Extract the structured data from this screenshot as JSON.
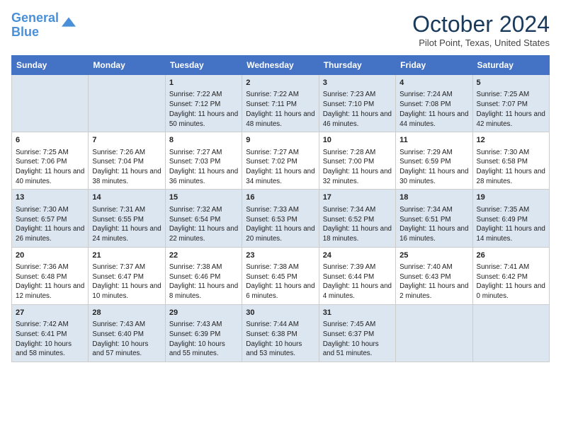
{
  "logo": {
    "line1": "General",
    "line2": "Blue"
  },
  "title": "October 2024",
  "location": "Pilot Point, Texas, United States",
  "days_of_week": [
    "Sunday",
    "Monday",
    "Tuesday",
    "Wednesday",
    "Thursday",
    "Friday",
    "Saturday"
  ],
  "weeks": [
    [
      {
        "day": "",
        "info": ""
      },
      {
        "day": "",
        "info": ""
      },
      {
        "day": "1",
        "info": "Sunrise: 7:22 AM\nSunset: 7:12 PM\nDaylight: 11 hours and 50 minutes."
      },
      {
        "day": "2",
        "info": "Sunrise: 7:22 AM\nSunset: 7:11 PM\nDaylight: 11 hours and 48 minutes."
      },
      {
        "day": "3",
        "info": "Sunrise: 7:23 AM\nSunset: 7:10 PM\nDaylight: 11 hours and 46 minutes."
      },
      {
        "day": "4",
        "info": "Sunrise: 7:24 AM\nSunset: 7:08 PM\nDaylight: 11 hours and 44 minutes."
      },
      {
        "day": "5",
        "info": "Sunrise: 7:25 AM\nSunset: 7:07 PM\nDaylight: 11 hours and 42 minutes."
      }
    ],
    [
      {
        "day": "6",
        "info": "Sunrise: 7:25 AM\nSunset: 7:06 PM\nDaylight: 11 hours and 40 minutes."
      },
      {
        "day": "7",
        "info": "Sunrise: 7:26 AM\nSunset: 7:04 PM\nDaylight: 11 hours and 38 minutes."
      },
      {
        "day": "8",
        "info": "Sunrise: 7:27 AM\nSunset: 7:03 PM\nDaylight: 11 hours and 36 minutes."
      },
      {
        "day": "9",
        "info": "Sunrise: 7:27 AM\nSunset: 7:02 PM\nDaylight: 11 hours and 34 minutes."
      },
      {
        "day": "10",
        "info": "Sunrise: 7:28 AM\nSunset: 7:00 PM\nDaylight: 11 hours and 32 minutes."
      },
      {
        "day": "11",
        "info": "Sunrise: 7:29 AM\nSunset: 6:59 PM\nDaylight: 11 hours and 30 minutes."
      },
      {
        "day": "12",
        "info": "Sunrise: 7:30 AM\nSunset: 6:58 PM\nDaylight: 11 hours and 28 minutes."
      }
    ],
    [
      {
        "day": "13",
        "info": "Sunrise: 7:30 AM\nSunset: 6:57 PM\nDaylight: 11 hours and 26 minutes."
      },
      {
        "day": "14",
        "info": "Sunrise: 7:31 AM\nSunset: 6:55 PM\nDaylight: 11 hours and 24 minutes."
      },
      {
        "day": "15",
        "info": "Sunrise: 7:32 AM\nSunset: 6:54 PM\nDaylight: 11 hours and 22 minutes."
      },
      {
        "day": "16",
        "info": "Sunrise: 7:33 AM\nSunset: 6:53 PM\nDaylight: 11 hours and 20 minutes."
      },
      {
        "day": "17",
        "info": "Sunrise: 7:34 AM\nSunset: 6:52 PM\nDaylight: 11 hours and 18 minutes."
      },
      {
        "day": "18",
        "info": "Sunrise: 7:34 AM\nSunset: 6:51 PM\nDaylight: 11 hours and 16 minutes."
      },
      {
        "day": "19",
        "info": "Sunrise: 7:35 AM\nSunset: 6:49 PM\nDaylight: 11 hours and 14 minutes."
      }
    ],
    [
      {
        "day": "20",
        "info": "Sunrise: 7:36 AM\nSunset: 6:48 PM\nDaylight: 11 hours and 12 minutes."
      },
      {
        "day": "21",
        "info": "Sunrise: 7:37 AM\nSunset: 6:47 PM\nDaylight: 11 hours and 10 minutes."
      },
      {
        "day": "22",
        "info": "Sunrise: 7:38 AM\nSunset: 6:46 PM\nDaylight: 11 hours and 8 minutes."
      },
      {
        "day": "23",
        "info": "Sunrise: 7:38 AM\nSunset: 6:45 PM\nDaylight: 11 hours and 6 minutes."
      },
      {
        "day": "24",
        "info": "Sunrise: 7:39 AM\nSunset: 6:44 PM\nDaylight: 11 hours and 4 minutes."
      },
      {
        "day": "25",
        "info": "Sunrise: 7:40 AM\nSunset: 6:43 PM\nDaylight: 11 hours and 2 minutes."
      },
      {
        "day": "26",
        "info": "Sunrise: 7:41 AM\nSunset: 6:42 PM\nDaylight: 11 hours and 0 minutes."
      }
    ],
    [
      {
        "day": "27",
        "info": "Sunrise: 7:42 AM\nSunset: 6:41 PM\nDaylight: 10 hours and 58 minutes."
      },
      {
        "day": "28",
        "info": "Sunrise: 7:43 AM\nSunset: 6:40 PM\nDaylight: 10 hours and 57 minutes."
      },
      {
        "day": "29",
        "info": "Sunrise: 7:43 AM\nSunset: 6:39 PM\nDaylight: 10 hours and 55 minutes."
      },
      {
        "day": "30",
        "info": "Sunrise: 7:44 AM\nSunset: 6:38 PM\nDaylight: 10 hours and 53 minutes."
      },
      {
        "day": "31",
        "info": "Sunrise: 7:45 AM\nSunset: 6:37 PM\nDaylight: 10 hours and 51 minutes."
      },
      {
        "day": "",
        "info": ""
      },
      {
        "day": "",
        "info": ""
      }
    ]
  ]
}
